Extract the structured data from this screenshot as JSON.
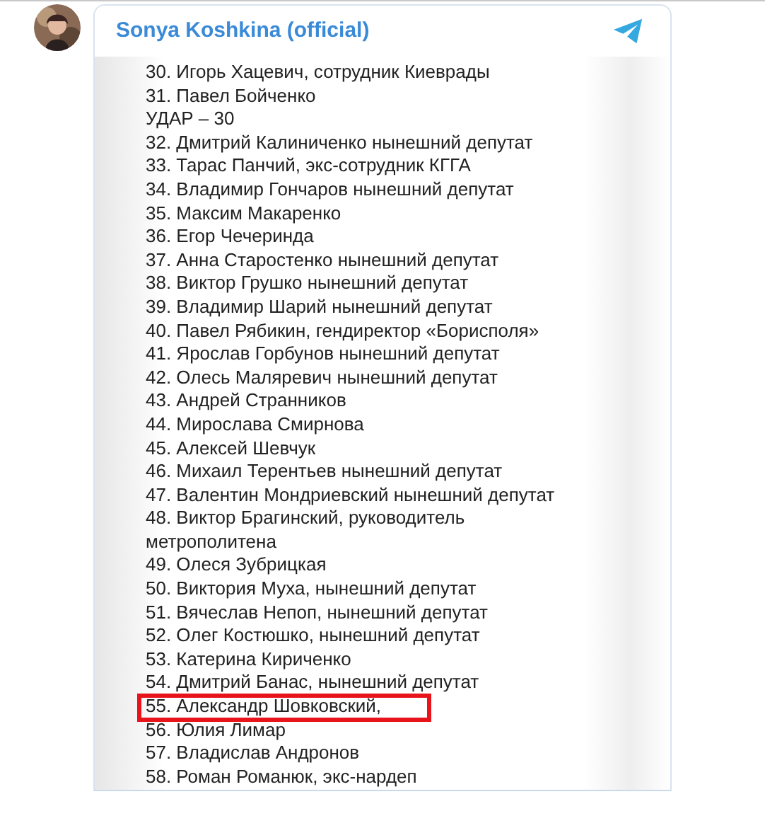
{
  "channel": {
    "name": "Sonya Koshkina (official)"
  },
  "post_image": {
    "lines": [
      {
        "text": "30. Игорь Хацевич, сотрудник Киеврады",
        "highlighted": false
      },
      {
        "text": "31. Павел Бойченко",
        "highlighted": false
      },
      {
        "text": "УДАР – 30",
        "highlighted": false
      },
      {
        "text": "32. Дмитрий Калиниченко нынешний депутат",
        "highlighted": false
      },
      {
        "text": "33. Тарас Панчий, экс-сотрудник КГГА",
        "highlighted": false
      },
      {
        "text": "34. Владимир Гончаров нынешний депутат",
        "highlighted": false
      },
      {
        "text": "35. Максим Макаренко",
        "highlighted": false
      },
      {
        "text": "36. Егор Чечеринда",
        "highlighted": false
      },
      {
        "text": "37. Анна Старостенко нынешний депутат",
        "highlighted": false
      },
      {
        "text": "38. Виктор Грушко нынешний депутат",
        "highlighted": false
      },
      {
        "text": "39. Владимир Шарий нынешний депутат",
        "highlighted": false
      },
      {
        "text": "40. Павел Рябикин, гендиректор «Борисполя»",
        "highlighted": false
      },
      {
        "text": "41. Ярослав Горбунов нынешний депутат",
        "highlighted": false
      },
      {
        "text": "42. Олесь Маляревич нынешний депутат",
        "highlighted": false
      },
      {
        "text": "43. Андрей Странников",
        "highlighted": false
      },
      {
        "text": "44. Мирослава Смирнова",
        "highlighted": false
      },
      {
        "text": "45. Алексей Шевчук",
        "highlighted": false
      },
      {
        "text": "46. Михаил Терентьев нынешний депутат",
        "highlighted": false
      },
      {
        "text": "47. Валентин Мондриевский нынешний депутат",
        "highlighted": false
      },
      {
        "text": "48. Виктор Брагинский, руководитель метрополитена",
        "highlighted": false
      },
      {
        "text": "49. Олеся Зубрицкая",
        "highlighted": false
      },
      {
        "text": "50. Виктория Муха, нынешний депутат",
        "highlighted": false
      },
      {
        "text": "51. Вячеслав Непоп, нынешний депутат",
        "highlighted": false
      },
      {
        "text": "52. Олег Костюшко, нынешний депутат",
        "highlighted": false
      },
      {
        "text": "53. Катерина Кириченко",
        "highlighted": false
      },
      {
        "text": "54. Дмитрий Банас, нынешний депутат",
        "highlighted": false
      },
      {
        "text": "55. Александр Шовковский,",
        "highlighted": true
      },
      {
        "text": "56. Юлия Лимар",
        "highlighted": false
      },
      {
        "text": "57. Владислав Андронов",
        "highlighted": false
      },
      {
        "text": "58. Роман Романюк, экс-нардеп",
        "highlighted": false
      }
    ]
  }
}
